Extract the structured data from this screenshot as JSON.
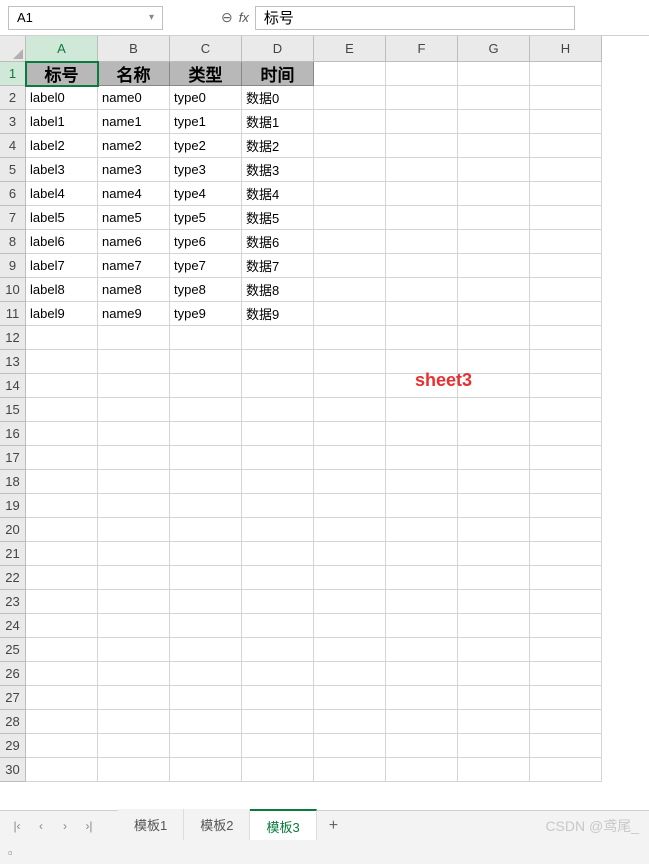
{
  "toolbar": {
    "name_box_value": "A1",
    "formula_value": "标号"
  },
  "columns": [
    "A",
    "B",
    "C",
    "D",
    "E",
    "F",
    "G",
    "H"
  ],
  "selected_column": "A",
  "selected_row": 1,
  "active_cell": "A1",
  "header_row": [
    "标号",
    "名称",
    "类型",
    "时间"
  ],
  "data_rows": [
    [
      "label0",
      "name0",
      "type0",
      "数据0"
    ],
    [
      "label1",
      "name1",
      "type1",
      "数据1"
    ],
    [
      "label2",
      "name2",
      "type2",
      "数据2"
    ],
    [
      "label3",
      "name3",
      "type3",
      "数据3"
    ],
    [
      "label4",
      "name4",
      "type4",
      "数据4"
    ],
    [
      "label5",
      "name5",
      "type5",
      "数据5"
    ],
    [
      "label6",
      "name6",
      "type6",
      "数据6"
    ],
    [
      "label7",
      "name7",
      "type7",
      "数据7"
    ],
    [
      "label8",
      "name8",
      "type8",
      "数据8"
    ],
    [
      "label9",
      "name9",
      "type9",
      "数据9"
    ]
  ],
  "total_rows": 30,
  "annotation": "sheet3",
  "tabs": {
    "items": [
      "模板1",
      "模板2",
      "模板3"
    ],
    "active_index": 2
  },
  "tab_nav": {
    "first": "|‹",
    "prev": "‹",
    "next": "›",
    "last": "›|"
  },
  "add_tab_label": "+",
  "watermark": "CSDN @鸢尾_"
}
